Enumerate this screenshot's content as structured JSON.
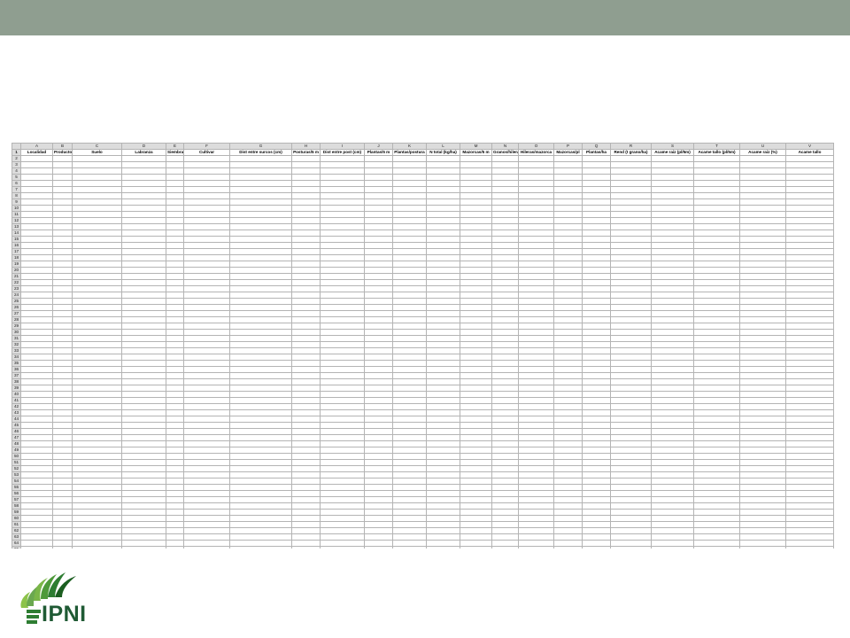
{
  "logo": {
    "text": "IPNI"
  },
  "sheet": {
    "columns": [
      "",
      "A",
      "B",
      "C",
      "D",
      "E",
      "F",
      "G",
      "H",
      "I",
      "J",
      "K",
      "L",
      "M",
      "N",
      "O",
      "P",
      "Q",
      "R",
      "S",
      "T",
      "U",
      "V"
    ],
    "headers": [
      "Localidad",
      "Productor",
      "Suelo",
      "Labranza",
      "Siembra",
      "Cultivar",
      "Dist entre surcos (cm)",
      "Posturas/5 m",
      "Dist entre post (cm)",
      "Plantas/5 m",
      "Plantas/postura",
      "N total (kg/ha)",
      "Mazorcas/5 m",
      "Granos/hilera",
      "Hileras/mazorca",
      "Mazorcas/pl",
      "Plantas/ha",
      "Rend (t grano/ha)",
      "Acame raiz (pl/5m)",
      "Acame tallo (pl/5m)",
      "Acame raiz (%)",
      "Acame tallo"
    ],
    "row_numbers": [
      2,
      3,
      4,
      5,
      6,
      7,
      8,
      9,
      10,
      11,
      12,
      13,
      14,
      15,
      16,
      17,
      18,
      19,
      20,
      21,
      22,
      23,
      24,
      25,
      26,
      27,
      28,
      29,
      30,
      31,
      32,
      33,
      34,
      35,
      36,
      37,
      38,
      39,
      40,
      41,
      42,
      43,
      44,
      45,
      46,
      47,
      48,
      49,
      50,
      51,
      52,
      53,
      54,
      55,
      56,
      57,
      58,
      59,
      60,
      61,
      62,
      63,
      64,
      65,
      66,
      67,
      68,
      69
    ],
    "rows": []
  }
}
